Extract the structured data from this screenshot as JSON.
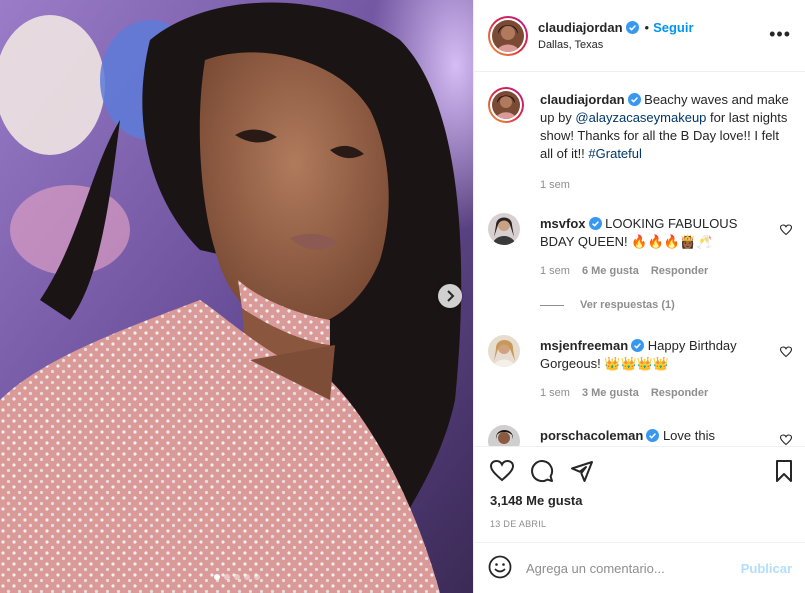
{
  "post": {
    "author": {
      "username": "claudiajordan",
      "verified": true,
      "location": "Dallas, Texas"
    },
    "follow_label": "Seguir",
    "separator": "•",
    "more_label": "•••",
    "carousel": {
      "slides": 5,
      "active_index": 0
    },
    "caption": {
      "username": "claudiajordan",
      "text_before_mention": "Beachy waves and make up by ",
      "mention": "@alayzacaseymakeup",
      "text_after_mention": " for last nights show! Thanks for all the B Day love!! I felt all of it!! ",
      "hashtag": "#Grateful",
      "time": "1 sem"
    },
    "comments": [
      {
        "username": "msvfox",
        "verified": true,
        "text": "LOOKING FABULOUS BDAY QUEEN! 🔥🔥🔥👸🏾🥂",
        "time": "1 sem",
        "likes": "6 Me gusta",
        "reply_label": "Responder",
        "view_replies": "Ver respuestas (1)"
      },
      {
        "username": "msjenfreeman",
        "verified": true,
        "text": "Happy Birthday Gorgeous! 👑👑👑👑",
        "time": "1 sem",
        "likes": "3 Me gusta",
        "reply_label": "Responder"
      },
      {
        "username": "porschacoleman",
        "verified": true,
        "text": "Love this"
      }
    ],
    "likes_count": "3,148 Me gusta",
    "date": "13 DE ABRIL",
    "add_comment": {
      "placeholder": "Agrega un comentario...",
      "publish_label": "Publicar"
    },
    "icons": {
      "like": "heart-icon",
      "comment": "comment-icon",
      "share": "share-icon",
      "save": "bookmark-icon",
      "emoji": "emoji-icon",
      "next": "chevron-right-icon"
    },
    "colors": {
      "accent": "#0095f6",
      "link": "#00376b",
      "muted": "#8e8e8e",
      "publish_disabled": "#b2dffc"
    }
  }
}
